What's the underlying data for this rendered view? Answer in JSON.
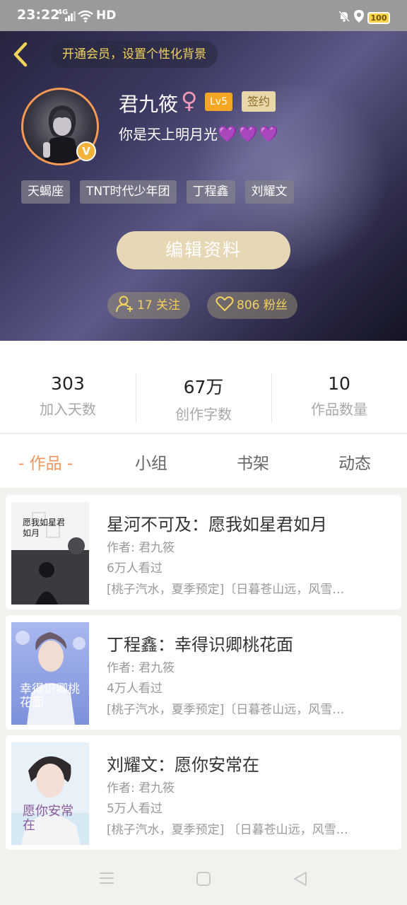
{
  "status_bar": {
    "time": "23:22",
    "signal": "4G",
    "network_label": "HD",
    "battery": "100"
  },
  "header": {
    "vip_prompt": "开通会员，设置个性化背景",
    "user_name": "君九筱",
    "gender_symbol": "♀",
    "level": "Lv5",
    "signed_badge": "签约",
    "verified_mark": "V",
    "bio": "你是天上明月光",
    "bio_emoji": "💜💜💜",
    "tags": [
      "天蝎座",
      "TNT时代少年团",
      "丁程鑫",
      "刘耀文"
    ],
    "edit_button": "编辑资料",
    "follow_count_label": "17 关注",
    "fans_count_label": "806 粉丝"
  },
  "stats": [
    {
      "value": "303",
      "label": "加入天数"
    },
    {
      "value": "67万",
      "label": "创作字数"
    },
    {
      "value": "10",
      "label": "作品数量"
    }
  ],
  "tabs": [
    {
      "label": "- 作品 -",
      "active": true
    },
    {
      "label": "小组",
      "active": false
    },
    {
      "label": "书架",
      "active": false
    },
    {
      "label": "动态",
      "active": false
    }
  ],
  "works": [
    {
      "title": "星河不可及：愿我如星君如月",
      "author": "作者: 君九筱",
      "views": "6万人看过",
      "tags": "[桃子汽水，夏季预定]〔日暮苍山远，风雪…",
      "cover_text": "愿我如星君如月"
    },
    {
      "title": "丁程鑫：幸得识卿桃花面",
      "author": "作者: 君九筱",
      "views": "4万人看过",
      "tags": "[桃子汽水，夏季预定]〔日暮苍山远，风雪…",
      "cover_text": "幸得识卿桃花面"
    },
    {
      "title": "刘耀文：愿你安常在",
      "author": "作者: 君九筱",
      "views": "5万人看过",
      "tags": "[桃子汽水，夏季预定] 〔日暮苍山远，风雪…",
      "cover_text": "愿你安常在"
    }
  ],
  "colors": {
    "accent": "#f0955b",
    "gold": "#f2d35c",
    "edit_button": "#e7d8b5",
    "level_badge": "#f5a623"
  },
  "icons": {
    "back": "chevron-left-icon",
    "follow": "user-plus-icon",
    "fans": "heart-outline-icon",
    "nav_menu": "menu-icon",
    "nav_home": "square-icon",
    "nav_back": "triangle-back-icon"
  }
}
